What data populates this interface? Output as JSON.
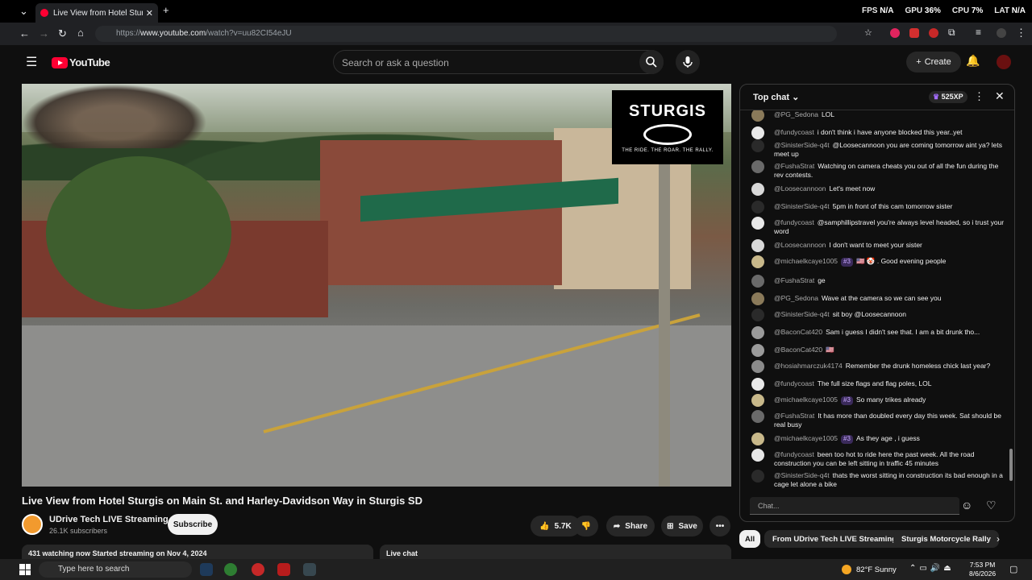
{
  "browser": {
    "tab_title": "Live View from Hotel Sturgis on",
    "url_prefix": "https://",
    "url_host": "www.youtube.com",
    "url_path": "/watch?v=uu82CI54eJU",
    "stats": {
      "fps_label": "FPS",
      "fps_value": "N/A",
      "gpu_label": "GPU",
      "gpu_value": "36%",
      "cpu_label": "CPU",
      "cpu_value": "7%",
      "lat_label": "LAT",
      "lat_value": "N/A"
    }
  },
  "youtube": {
    "logo_text": "YouTube",
    "search_placeholder": "Search or ask a question",
    "create_label": "Create"
  },
  "video": {
    "overlay_brand": "STURGIS",
    "overlay_tagline": "THE RIDE. THE ROAR. THE RALLY.",
    "title": "Live View from Hotel Sturgis on Main St. and Harley-Davidson Way in Sturgis SD",
    "channel_name": "UDrive Tech LIVE Streaming",
    "subscribers": "26.1K subscribers",
    "subscribe_label": "Subscribe",
    "likes": "5.7K",
    "share_label": "Share",
    "save_label": "Save",
    "description_line": "431 watching now  Started streaming on Nov 4, 2024",
    "livechat_label": "Live chat"
  },
  "chat": {
    "header": "Top chat",
    "xp": "525XP",
    "input_placeholder": "Chat...",
    "messages": [
      {
        "user": "@PG_Sedona",
        "text": "LOL",
        "avatar": "#8a7a5a"
      },
      {
        "user": "@fundycoast",
        "text": "i don't think i have anyone blocked this year..yet",
        "avatar": "#e8e8e8"
      },
      {
        "user": "@SinisterSide-q4t",
        "text": "@Loosecannoon you are coming tomorrow aint ya? lets meet up",
        "avatar": "#2a2a2a"
      },
      {
        "user": "@FushaStrat",
        "text": "Watching on camera cheats you out of all the fun during the rev contests.",
        "avatar": "#6a6a6a"
      },
      {
        "user": "@Loosecannoon",
        "text": "Let's meet now",
        "avatar": "#d8d8d8"
      },
      {
        "user": "@SinisterSide-q4t",
        "text": "5pm in front of this cam tomorrow sister",
        "avatar": "#2a2a2a"
      },
      {
        "user": "@fundycoast",
        "text": "@samphillipstravel you're always level headed, so i trust your word",
        "avatar": "#e8e8e8"
      },
      {
        "user": "@Loosecannoon",
        "text": "I don't want to meet your sister",
        "avatar": "#d8d8d8"
      },
      {
        "user": "@michaelkcaye1005",
        "badge": "#3",
        "text": "🇺🇸 🤡 . Good evening people",
        "avatar": "#c8b88a"
      },
      {
        "user": "@FushaStrat",
        "text": "ge",
        "avatar": "#6a6a6a"
      },
      {
        "user": "@PG_Sedona",
        "text": "Wave at the camera so we can see you",
        "avatar": "#8a7a5a"
      },
      {
        "user": "@SinisterSide-q4t",
        "text": "sit boy @Loosecannoon",
        "avatar": "#2a2a2a"
      },
      {
        "user": "@BaconCat420",
        "text": "Sam i guess I didn't see that. I am a bit drunk tho...",
        "avatar": "#9a9a9a"
      },
      {
        "user": "@BaconCat420",
        "text": "🇺🇸",
        "avatar": "#9a9a9a"
      },
      {
        "user": "@hosiahmarczuk4174",
        "text": "Remember the drunk homeless chick last year?",
        "avatar": "#8a8a8a"
      },
      {
        "user": "@fundycoast",
        "text": "The full size flags and flag poles, LOL",
        "avatar": "#e8e8e8"
      },
      {
        "user": "@michaelkcaye1005",
        "badge": "#3",
        "text": "So many trikes already",
        "avatar": "#c8b88a"
      },
      {
        "user": "@FushaStrat",
        "text": "It has more than doubled every day this week. Sat should be real busy",
        "avatar": "#6a6a6a"
      },
      {
        "user": "@michaelkcaye1005",
        "badge": "#3",
        "text": "As they age , i guess",
        "avatar": "#c8b88a"
      },
      {
        "user": "@fundycoast",
        "text": "been too hot to ride here the past week. All the road construction you can be left sitting in traffic 45 minutes",
        "avatar": "#e8e8e8"
      },
      {
        "user": "@SinisterSide-q4t",
        "text": "thats the worst sitting in construction its bad enough in a cage let alone a bike",
        "avatar": "#2a2a2a"
      }
    ]
  },
  "chips": [
    "All",
    "From UDrive Tech LIVE Streaming",
    "Sturgis Motorcycle Rally"
  ],
  "taskbar": {
    "search_placeholder": "Type here to search",
    "weather": "82°F  Sunny",
    "time": "7:53 PM",
    "date": "8/6/2026"
  }
}
